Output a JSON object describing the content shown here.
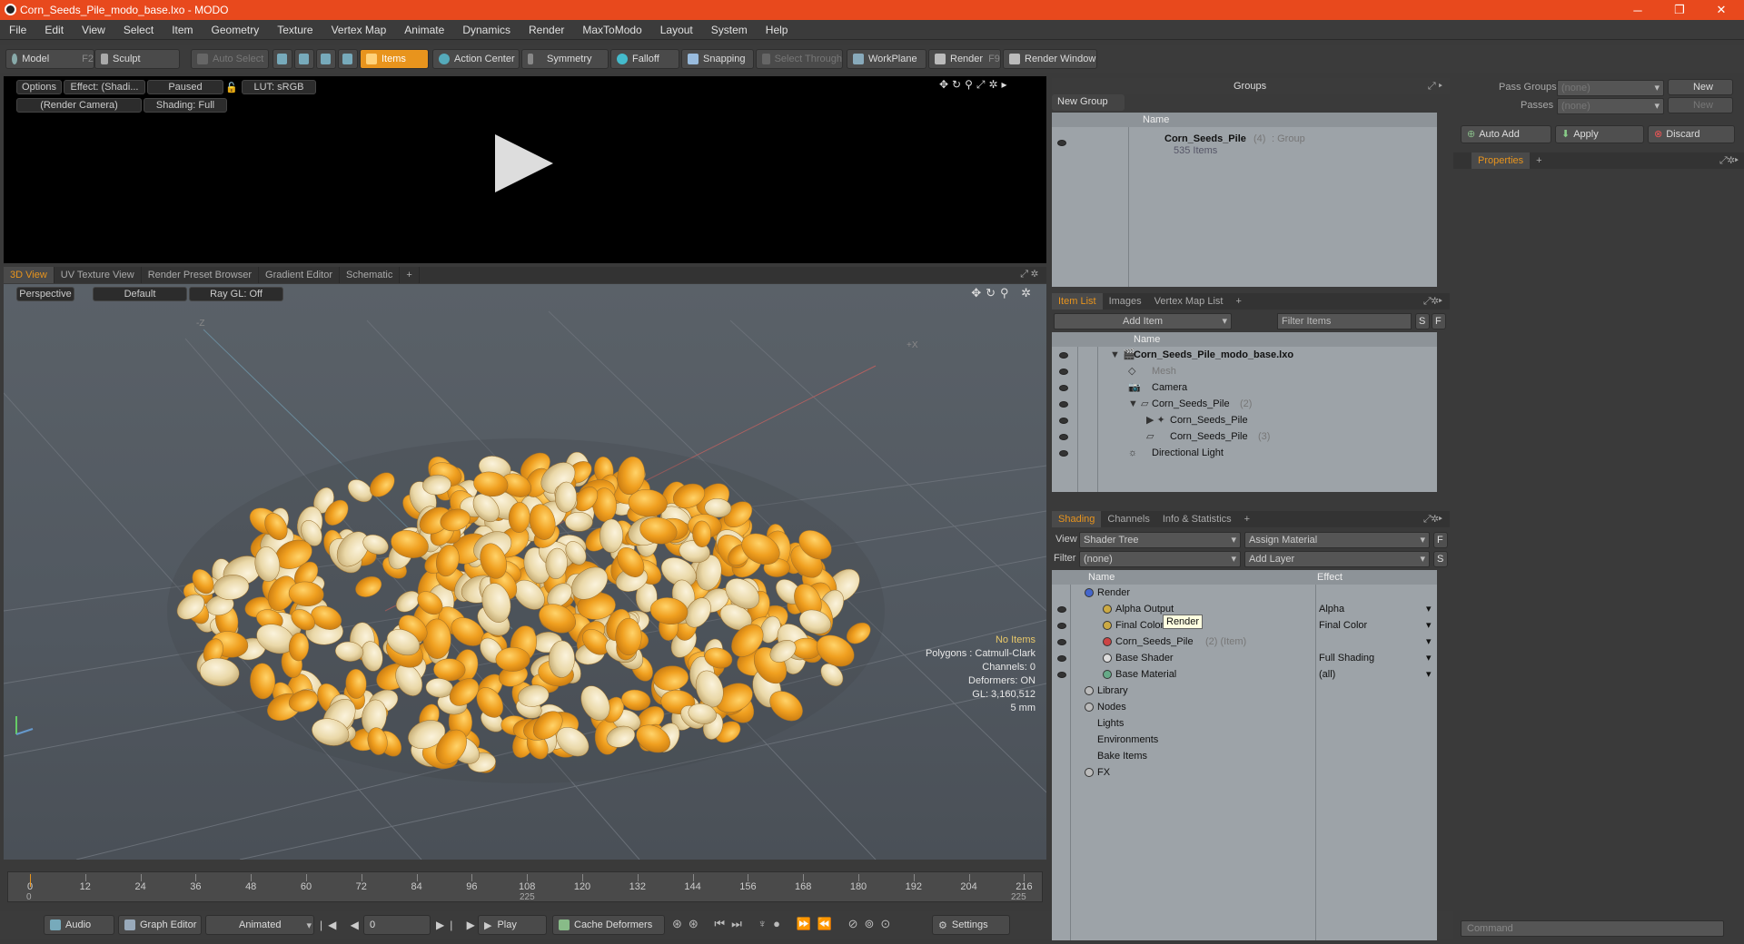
{
  "window": {
    "title": "Corn_Seeds_Pile_modo_base.lxo - MODO",
    "minimize": "─",
    "maximize": "❐",
    "close": "✕"
  },
  "menu": [
    "File",
    "Edit",
    "View",
    "Select",
    "Item",
    "Geometry",
    "Texture",
    "Vertex Map",
    "Animate",
    "Dynamics",
    "Render",
    "MaxToModo",
    "Layout",
    "System",
    "Help"
  ],
  "toolbar": {
    "model": "Model",
    "model_key": "F2",
    "sculpt": "Sculpt",
    "auto_select": "Auto Select",
    "items": "Items",
    "action_center": "Action Center",
    "symmetry": "Symmetry",
    "falloff": "Falloff",
    "snapping": "Snapping",
    "select_through": "Select Through",
    "workplane": "WorkPlane",
    "render": "Render",
    "render_key": "F9",
    "render_window": "Render Window"
  },
  "preview": {
    "options": "Options",
    "effect": "Effect: (Shadi...",
    "paused": "Paused",
    "lut": "LUT: sRGB",
    "camera": "(Render Camera)",
    "shading": "Shading: Full"
  },
  "viewport_tabs": [
    "3D View",
    "UV Texture View",
    "Render Preset Browser",
    "Gradient Editor",
    "Schematic",
    "+"
  ],
  "viewport": {
    "perspective": "Perspective",
    "default": "Default",
    "raygl": "Ray GL: Off",
    "axis_z": "-Z",
    "axis_x": "+X",
    "info": {
      "no_items": "No Items",
      "polygons": "Polygons : Catmull-Clark",
      "channels": "Channels: 0",
      "deformers": "Deformers: ON",
      "gl": "GL: 3,160,512",
      "unit": "5 mm"
    }
  },
  "timeline": {
    "ticks": [
      "0",
      "12",
      "24",
      "36",
      "48",
      "60",
      "72",
      "84",
      "96",
      "108",
      "120",
      "132",
      "144",
      "156",
      "168",
      "180",
      "192",
      "204",
      "216"
    ],
    "start": "0",
    "mid": "225",
    "end": "225"
  },
  "bottom": {
    "audio": "Audio",
    "graph_editor": "Graph Editor",
    "animated": "Animated",
    "frame": "0",
    "play": "Play",
    "cache_deformers": "Cache Deformers",
    "settings": "Settings"
  },
  "groups": {
    "title": "Groups",
    "new_group": "New Group",
    "col_name": "Name",
    "item_name": "Corn_Seeds_Pile",
    "item_count": "(4)",
    "item_type": ": Group",
    "item_sub": "535 Items"
  },
  "passes": {
    "pass_groups": "Pass Groups",
    "passes": "Passes",
    "none1": "(none)",
    "none2": "(none)",
    "new1": "New",
    "new2": "New"
  },
  "props": {
    "auto_add": "Auto Add",
    "apply": "Apply",
    "discard": "Discard",
    "tab": "Properties",
    "plus": "+"
  },
  "itemlist": {
    "tabs": [
      "Item List",
      "Images",
      "Vertex Map List",
      "+"
    ],
    "add_item": "Add Item",
    "filter": "Filter Items",
    "s": "S",
    "f": "F",
    "col_name": "Name",
    "rows": [
      {
        "label": "Corn_Seeds_Pile_modo_base.lxo",
        "extra": ""
      },
      {
        "label": "Mesh",
        "extra": ""
      },
      {
        "label": "Camera",
        "extra": ""
      },
      {
        "label": "Corn_Seeds_Pile",
        "extra": "(2)"
      },
      {
        "label": "Corn_Seeds_Pile",
        "extra": ""
      },
      {
        "label": "Corn_Seeds_Pile",
        "extra": "(3)"
      },
      {
        "label": "Directional Light",
        "extra": ""
      }
    ]
  },
  "shading": {
    "tabs": [
      "Shading",
      "Channels",
      "Info & Statistics",
      "+"
    ],
    "view_label": "View",
    "view_value": "Shader Tree",
    "assign_material": "Assign Material",
    "f": "F",
    "filter_label": "Filter",
    "filter_value": "(none)",
    "add_layer": "Add Layer",
    "s": "S",
    "col_name": "Name",
    "col_effect": "Effect",
    "rows": [
      {
        "label": "Render",
        "extra": "",
        "effect": ""
      },
      {
        "label": "Alpha Output",
        "extra": "",
        "effect": "Alpha"
      },
      {
        "label": "Final Color",
        "extra": "",
        "effect": "Final Color"
      },
      {
        "label": "Corn_Seeds_Pile",
        "extra": "(2) (Item)",
        "effect": ""
      },
      {
        "label": "Base Shader",
        "extra": "",
        "effect": "Full Shading"
      },
      {
        "label": "Base Material",
        "extra": "",
        "effect": "(all)"
      },
      {
        "label": "Library",
        "extra": "",
        "effect": ""
      },
      {
        "label": "Nodes",
        "extra": "",
        "effect": ""
      },
      {
        "label": "Lights",
        "extra": "",
        "effect": ""
      },
      {
        "label": "Environments",
        "extra": "",
        "effect": ""
      },
      {
        "label": "Bake Items",
        "extra": "",
        "effect": ""
      },
      {
        "label": "FX",
        "extra": "",
        "effect": ""
      }
    ],
    "tooltip": "Render"
  },
  "command": {
    "placeholder": "Command"
  },
  "colors": {
    "accent": "#e8941d",
    "titlebar": "#e8491d",
    "list_bg": "#9da3a8"
  }
}
